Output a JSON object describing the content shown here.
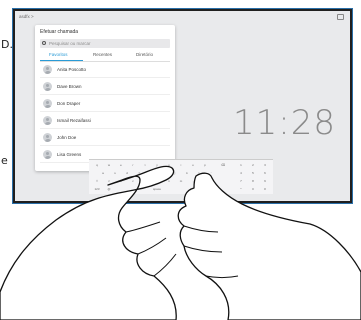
{
  "caption": {
    "left_fragment": "D.",
    "bottom_fragment": "e"
  },
  "status_bar": {
    "breadcrumb": "asdfx >"
  },
  "clock": {
    "time": "11:28"
  },
  "call_panel": {
    "title": "Efetuar chamada",
    "search_placeholder": "Pesquisar ou marcar",
    "tabs": [
      {
        "label": "Favoritos",
        "active": true
      },
      {
        "label": "Recentes",
        "active": false
      },
      {
        "label": "Diretório",
        "active": false
      }
    ],
    "contacts": [
      {
        "name": "Anita Poscotto"
      },
      {
        "name": "Dave Brown"
      },
      {
        "name": "Don Draper"
      },
      {
        "name": "Ismail Rezaifassi"
      },
      {
        "name": "John Doe"
      },
      {
        "name": "Lisa Greens"
      }
    ]
  },
  "keyboard": {
    "rows": [
      [
        "q",
        "w",
        "e",
        "r",
        "t",
        "y",
        "u",
        "i",
        "o",
        "p",
        "⌫",
        "1",
        "2",
        "3"
      ],
      [
        "a",
        "s",
        "d",
        "f",
        "g",
        "h",
        "j",
        "k",
        "l",
        "'",
        "4",
        "5",
        "6"
      ],
      [
        "⇧",
        "z",
        "x",
        "c",
        "v",
        "b",
        "n",
        "m",
        ",",
        ".",
        "7",
        "8",
        "9"
      ],
      [
        "123",
        "@",
        "space",
        "*",
        "0",
        "#"
      ]
    ]
  },
  "colors": {
    "accent": "#2a9bd6",
    "screen_bg": "#e9eaec",
    "device_frame": "#1f1f1f"
  }
}
